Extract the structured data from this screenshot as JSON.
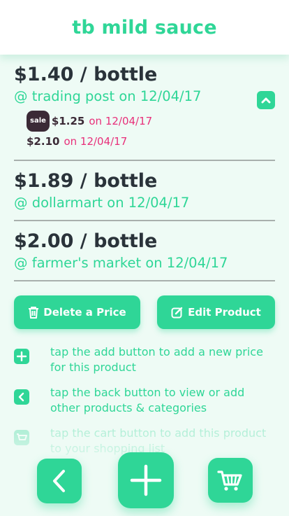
{
  "header": {
    "title": "tb mild sauce"
  },
  "prices": [
    {
      "price": "$1.40 / bottle",
      "store": "@ trading post on 12/04/17",
      "history": [
        {
          "badge": "sale",
          "amount": "$1.25",
          "date": "on 12/04/17"
        },
        {
          "badge": "",
          "amount": "$2.10",
          "date": "on 12/04/17"
        }
      ]
    },
    {
      "price": "$1.89 / bottle",
      "store": "@ dollarmart on 12/04/17"
    },
    {
      "price": "$2.00 / bottle",
      "store": "@ farmer's market on 12/04/17"
    }
  ],
  "actions": {
    "delete_label": "Delete a Price",
    "edit_label": "Edit Product"
  },
  "hints": [
    {
      "icon": "plus-icon",
      "text": "tap the add button to add a new price for this product"
    },
    {
      "icon": "chevron-left-icon",
      "text": "tap the back button to view or add other products & categories"
    },
    {
      "icon": "cart-icon",
      "text": "tap the cart button to add this product to your shopping list"
    }
  ],
  "nav": {
    "back": "chevron-left-icon",
    "add": "plus-icon",
    "cart": "cart-icon"
  },
  "colors": {
    "accent": "#2fd697",
    "text": "#2a333a",
    "sale": "#e8307a",
    "background": "#eefbf5"
  }
}
